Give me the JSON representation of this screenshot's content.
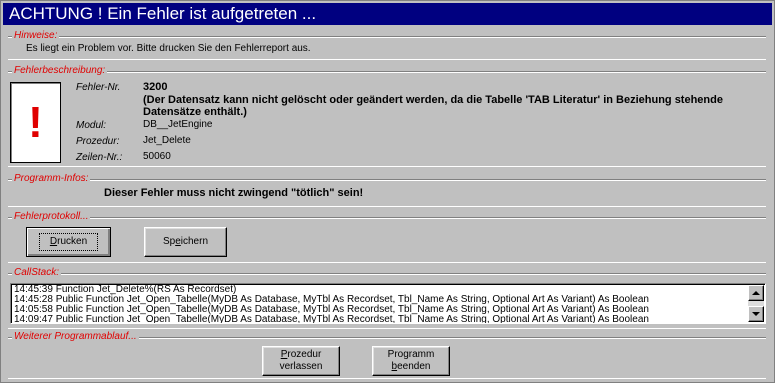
{
  "window": {
    "title": "ACHTUNG ! Ein Fehler ist aufgetreten ..."
  },
  "hinweise": {
    "label": "Hinweise:",
    "text": "Es liegt ein Problem vor. Bitte drucken Sie den Fehlerreport aus."
  },
  "fehlerbeschreibung": {
    "label": "Fehlerbeschreibung:",
    "icon": "exclamation-icon",
    "fehler_nr_label": "Fehler-Nr.",
    "fehler_nr": "3200",
    "message_line1": "(Der Datensatz kann nicht gelöscht oder geändert werden, da die Tabelle 'TAB Literatur' in Beziehung stehende",
    "message_line2": "Datensätze enthält.)",
    "modul_label": "Modul:",
    "modul": "DB__JetEngine",
    "prozedur_label": "Prozedur:",
    "prozedur": "Jet_Delete",
    "zeilen_label": "Zeilen-Nr.:",
    "zeilen": "50060"
  },
  "programm_infos": {
    "label": "Programm-Infos:",
    "text": "Dieser Fehler muss nicht zwingend \"tötlich\" sein!"
  },
  "fehlerprotokoll": {
    "label": "Fehlerprotokoll...",
    "drucken_rest": "rucken",
    "drucken_accel": "D",
    "speichern_pre": "Sp",
    "speichern_accel": "e",
    "speichern_rest": "ichern"
  },
  "callstack": {
    "label": "CallStack:",
    "lines": [
      "14:45:39 Function Jet_Delete%(RS As Recordset)",
      "14:45:28 Public Function Jet_Open_Tabelle(MyDB As Database, MyTbl As Recordset, Tbl_Name As String, Optional Art As Variant) As Boolean",
      "14:05:58 Public Function Jet_Open_Tabelle(MyDB As Database, MyTbl As Recordset, Tbl_Name As String, Optional Art As Variant) As Boolean",
      "14:09:47 Public Function Jet_Open_Tabelle(MyDB As Database, MyTbl As Recordset, Tbl_Name As String, Optional Art As Variant) As Boolean"
    ]
  },
  "weiterer": {
    "label": "Weiterer Programmablauf...",
    "prozedur_line1_accel": "P",
    "prozedur_line1_rest": "rozedur",
    "prozedur_line2": "verlassen",
    "programm_line1": "Programm",
    "programm_line2_accel": "b",
    "programm_line2_pre": "",
    "programm_line2_rest": "eenden"
  }
}
